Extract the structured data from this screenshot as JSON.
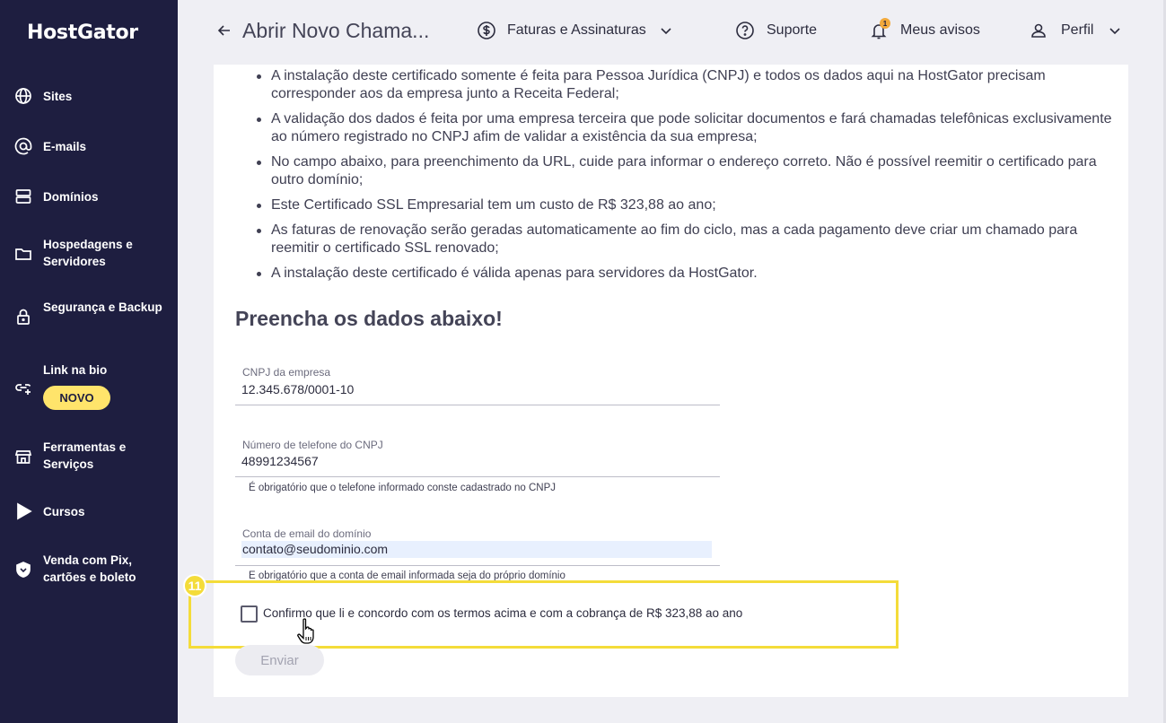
{
  "brand": {
    "logo": "HostGator"
  },
  "sidebar": {
    "items": [
      {
        "label": "Sites",
        "icon": "globe-icon"
      },
      {
        "label": "E-mails",
        "icon": "at-icon"
      },
      {
        "label": "Domínios",
        "icon": "server-icon"
      },
      {
        "label": "Hospedagens e Servidores",
        "icon": "folder-icon"
      },
      {
        "label": "Segurança e Backup",
        "icon": "lock-icon"
      },
      {
        "label": "Link na bio",
        "icon": "link-icon",
        "badge": "NOVO"
      },
      {
        "label": "Ferramentas e Serviços",
        "icon": "store-icon"
      },
      {
        "label": "Cursos",
        "icon": "play-icon"
      },
      {
        "label": "Venda com Pix, cartões e boleto",
        "icon": "shield-icon"
      }
    ]
  },
  "header": {
    "page_title": "Abrir Novo Chama...",
    "billing": "Faturas e Assinaturas",
    "support": "Suporte",
    "notifications": "Meus avisos",
    "notifications_count": "1",
    "profile": "Perfil"
  },
  "content": {
    "bullets": [
      "A instalação deste certificado somente é feita para Pessoa Jurídica (CNPJ) e todos os dados aqui na HostGator precisam corresponder aos da empresa junto a Receita Federal;",
      "A validação dos dados é feita por uma empresa terceira que pode solicitar documentos e fará chamadas telefônicas exclusivamente ao número registrado no CNPJ afim de validar a existência da sua empresa;",
      "No campo abaixo, para preenchimento da URL, cuide para informar o endereço correto. Não é possível reemitir o certificado para outro domínio;",
      "Este Certificado SSL Empresarial tem um custo de R$ 323,88 ao ano;",
      "As faturas de renovação serão geradas automaticamente ao fim do ciclo, mas a cada pagamento deve criar um chamado para reemitir o certificado SSL renovado;",
      "A instalação deste certificado é válida apenas para servidores da HostGator."
    ],
    "section_title": "Preencha os dados abaixo!",
    "form": {
      "cnpj_label": "CNPJ da empresa",
      "cnpj_value": "12.345.678/0001-10",
      "phone_label": "Número de telefone do CNPJ",
      "phone_value": "48991234567",
      "phone_helper": "É obrigatório que o telefone informado conste cadastrado no CNPJ",
      "email_label": "Conta de email do domínio",
      "email_value": "contato@seudominio.com",
      "email_helper": "É obrigatório que a conta de email informada seja do próprio domínio",
      "confirm_label": "Confirmo que li e concordo com os termos acima e com a cobrança de R$ 323,88 ao ano",
      "confirm_checked": false,
      "submit": "Enviar"
    },
    "step_number": "11"
  },
  "colors": {
    "sidebar_bg": "#1e1e40",
    "badge_yellow": "#ffe46b",
    "highlight": "#f4dc3a",
    "notification": "#f2a93b"
  }
}
